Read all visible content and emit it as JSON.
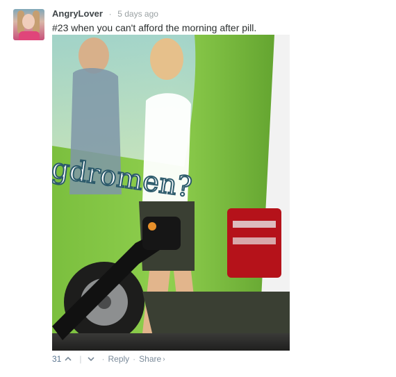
{
  "comment": {
    "author": "AngryLover",
    "separator": "·",
    "timestamp": "5 days ago",
    "message": "#23 when you can't afford the morning after pill.",
    "avatar_icon": "user-avatar",
    "image_text": "gdromen?"
  },
  "footer": {
    "votes": "31",
    "upvote_icon": "chevron-up-icon",
    "downvote_icon": "chevron-down-icon",
    "divider": "|",
    "dot": "·",
    "reply_label": "Reply",
    "share_label": "Share",
    "share_arrow": "›"
  }
}
